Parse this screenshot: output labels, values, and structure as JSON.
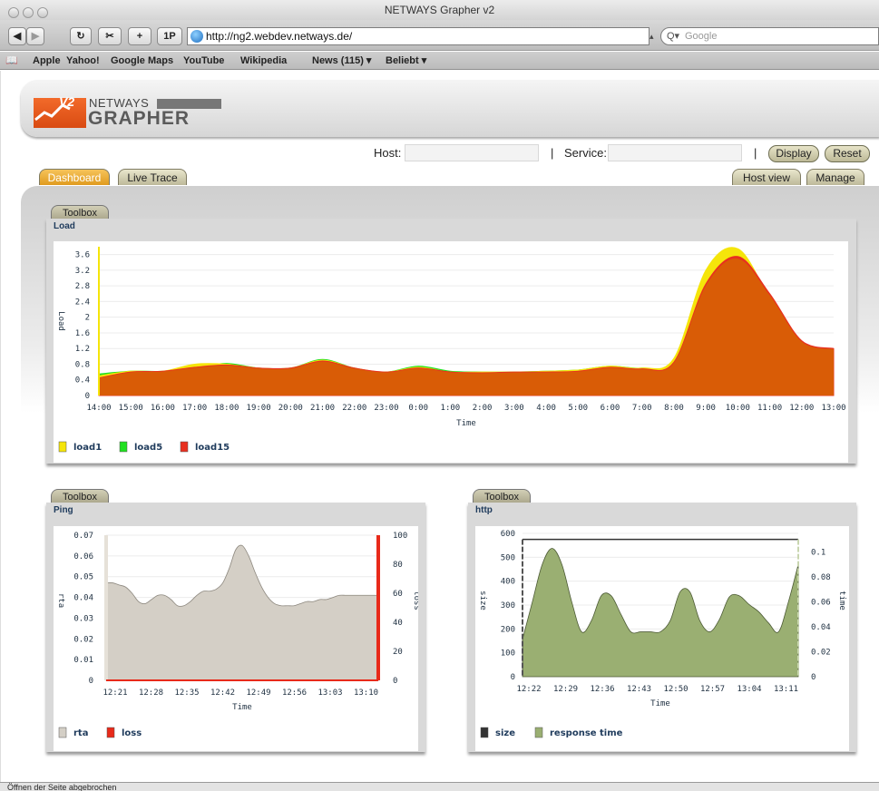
{
  "window": {
    "title": "NETWAYS Grapher v2"
  },
  "browser": {
    "url": "http://ng2.webdev.netways.de/",
    "search_placeholder": "Google",
    "buttons": {
      "back": "◀",
      "forward": "▶",
      "reload": "↻",
      "snap": "✂",
      "add": "+",
      "onepass": "1P"
    },
    "bookmarks": [
      "Apple",
      "Yahoo!",
      "Google Maps",
      "YouTube",
      "Wikipedia",
      "News (115) ▾",
      "Beliebt ▾"
    ]
  },
  "logo": {
    "v2": "V2",
    "netways": "NETWAYS",
    "grapher": "GRAPHER"
  },
  "filter": {
    "host_label": "Host:",
    "service_label": "Service:",
    "separator": "|",
    "display": "Display",
    "reset": "Reset"
  },
  "tabs": {
    "dashboard": "Dashboard",
    "live_trace": "Live Trace",
    "host_view": "Host view",
    "manage": "Manage"
  },
  "status_text": "Öffnen der Seite abgebrochen",
  "chart_data": [
    {
      "id": "load",
      "type": "area",
      "toolbox": "Toolbox",
      "title": "Load",
      "xlabel": "Time",
      "ylabel": "Load",
      "ylim": [
        0,
        3.8
      ],
      "yticks": [
        "0",
        "0.4",
        "0.8",
        "1.2",
        "1.6",
        "2",
        "2.4",
        "2.8",
        "3.2",
        "3.6"
      ],
      "categories": [
        "14:00",
        "15:00",
        "16:00",
        "17:00",
        "18:00",
        "19:00",
        "20:00",
        "21:00",
        "22:00",
        "23:00",
        "0:00",
        "1:00",
        "2:00",
        "3:00",
        "4:00",
        "5:00",
        "6:00",
        "7:00",
        "8:00",
        "9:00",
        "10:00",
        "11:00",
        "12:00",
        "13:00"
      ],
      "series": [
        {
          "name": "load1",
          "color": "#f5e50a",
          "values": [
            0.5,
            0.62,
            0.62,
            0.8,
            0.8,
            0.7,
            0.7,
            0.9,
            0.7,
            0.6,
            0.72,
            0.6,
            0.6,
            0.6,
            0.62,
            0.65,
            0.75,
            0.7,
            0.95,
            3.2,
            3.75,
            2.5,
            1.3,
            1.15
          ]
        },
        {
          "name": "load5",
          "color": "#20e020",
          "values": [
            0.55,
            0.62,
            0.62,
            0.72,
            0.82,
            0.7,
            0.7,
            0.92,
            0.7,
            0.6,
            0.75,
            0.62,
            0.6,
            0.6,
            0.62,
            0.65,
            0.75,
            0.7,
            0.9,
            3.0,
            3.7,
            2.5,
            1.3,
            1.15
          ]
        },
        {
          "name": "load15",
          "color": "#e83020",
          "values": [
            0.45,
            0.6,
            0.62,
            0.72,
            0.78,
            0.7,
            0.7,
            0.88,
            0.7,
            0.6,
            0.7,
            0.6,
            0.58,
            0.6,
            0.6,
            0.62,
            0.72,
            0.68,
            0.85,
            2.85,
            3.55,
            2.6,
            1.4,
            1.2
          ]
        }
      ]
    },
    {
      "id": "ping",
      "type": "area",
      "toolbox": "Toolbox",
      "title": "Ping",
      "xlabel": "Time",
      "ylabel": "rta",
      "y2label": "loss",
      "ylim": [
        0,
        0.07
      ],
      "y2lim": [
        0,
        100
      ],
      "yticks": [
        "0",
        "0.01",
        "0.02",
        "0.03",
        "0.04",
        "0.05",
        "0.06",
        "0.07"
      ],
      "y2ticks": [
        "0",
        "20",
        "40",
        "60",
        "80",
        "100"
      ],
      "categories": [
        "12:21",
        "12:28",
        "12:35",
        "12:42",
        "12:49",
        "12:56",
        "13:03",
        "13:10"
      ],
      "x": [
        0,
        1,
        2,
        3,
        4,
        5,
        6,
        7,
        8,
        9,
        10,
        11,
        12,
        13,
        14,
        15,
        16,
        17,
        18,
        19,
        20,
        21,
        22,
        23,
        24,
        25,
        26,
        27,
        28,
        29,
        30,
        31,
        32,
        33,
        34,
        35,
        36,
        37,
        38,
        39,
        40,
        41,
        42
      ],
      "series": [
        {
          "name": "rta",
          "color": "#d4cfc6",
          "values": [
            0.047,
            0.047,
            0.046,
            0.045,
            0.042,
            0.038,
            0.037,
            0.039,
            0.041,
            0.041,
            0.039,
            0.036,
            0.036,
            0.038,
            0.041,
            0.043,
            0.043,
            0.044,
            0.047,
            0.054,
            0.063,
            0.065,
            0.06,
            0.052,
            0.045,
            0.04,
            0.037,
            0.036,
            0.036,
            0.036,
            0.037,
            0.038,
            0.038,
            0.039,
            0.039,
            0.04,
            0.041,
            0.041,
            0.041,
            0.041,
            0.041,
            0.041,
            0.041
          ]
        },
        {
          "name": "loss",
          "color": "#e82a1a",
          "values": [
            0,
            0,
            0,
            0,
            0,
            0,
            0,
            0,
            0,
            0,
            0,
            0,
            0,
            0,
            0,
            0,
            0,
            0,
            0,
            0,
            0,
            0,
            0,
            0,
            0,
            0,
            0,
            0,
            0,
            0,
            0,
            0,
            0,
            0,
            0,
            0,
            0,
            0,
            0,
            0,
            0,
            0,
            0
          ]
        }
      ]
    },
    {
      "id": "http",
      "type": "area",
      "toolbox": "Toolbox",
      "title": "http",
      "xlabel": "Time",
      "ylabel": "size",
      "y2label": "time",
      "ylim": [
        0,
        600
      ],
      "y2lim": [
        0,
        0.115
      ],
      "yticks": [
        "0",
        "100",
        "200",
        "300",
        "400",
        "500",
        "600"
      ],
      "y2ticks": [
        "0",
        "0.02",
        "0.04",
        "0.06",
        "0.08",
        "0.1"
      ],
      "categories": [
        "12:22",
        "12:29",
        "12:36",
        "12:43",
        "12:50",
        "12:57",
        "13:04",
        "13:11"
      ],
      "series": [
        {
          "name": "size",
          "color": "#333333",
          "values": [
            575,
            575,
            575,
            575,
            575,
            575,
            575,
            575,
            575,
            575,
            575,
            575,
            575,
            575,
            575,
            575,
            575,
            575,
            575,
            575,
            575,
            575,
            575,
            575,
            575,
            575,
            575,
            575,
            575,
            575,
            575,
            575,
            575,
            575,
            575,
            575,
            575,
            575,
            575,
            575,
            575,
            575,
            575,
            575,
            575,
            575,
            575,
            575,
            575,
            575,
            575,
            575,
            575,
            575,
            575,
            575,
            575,
            575,
            575,
            575,
            575,
            575,
            575,
            575,
            575,
            575,
            575,
            575,
            575,
            575,
            575,
            575,
            575,
            575,
            575,
            575,
            575,
            575,
            575,
            575,
            575,
            575,
            575,
            575,
            575,
            575,
            575,
            575,
            575,
            575,
            575,
            575,
            575,
            575,
            575,
            575,
            575,
            575,
            575,
            575,
            575,
            575
          ]
        },
        {
          "name": "response time",
          "color": "#9aaf72",
          "values": [
            0.03,
            0.06,
            0.09,
            0.103,
            0.09,
            0.06,
            0.036,
            0.045,
            0.065,
            0.065,
            0.05,
            0.036,
            0.036,
            0.036,
            0.036,
            0.045,
            0.068,
            0.068,
            0.045,
            0.036,
            0.046,
            0.064,
            0.065,
            0.058,
            0.052,
            0.043,
            0.036,
            0.06,
            0.09
          ]
        }
      ]
    }
  ]
}
